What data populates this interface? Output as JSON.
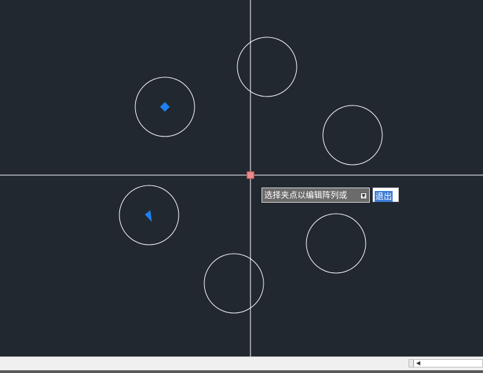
{
  "canvas": {
    "background": "#212830",
    "entity_color": "#ffffff",
    "grip_color": "#1e7ff0",
    "base_grip_color": "#f08a8a"
  },
  "prompt": {
    "text": "选择夹点以编辑阵列或",
    "dropdown_icon": "arrow-down-icon"
  },
  "input": {
    "value": "退出"
  }
}
